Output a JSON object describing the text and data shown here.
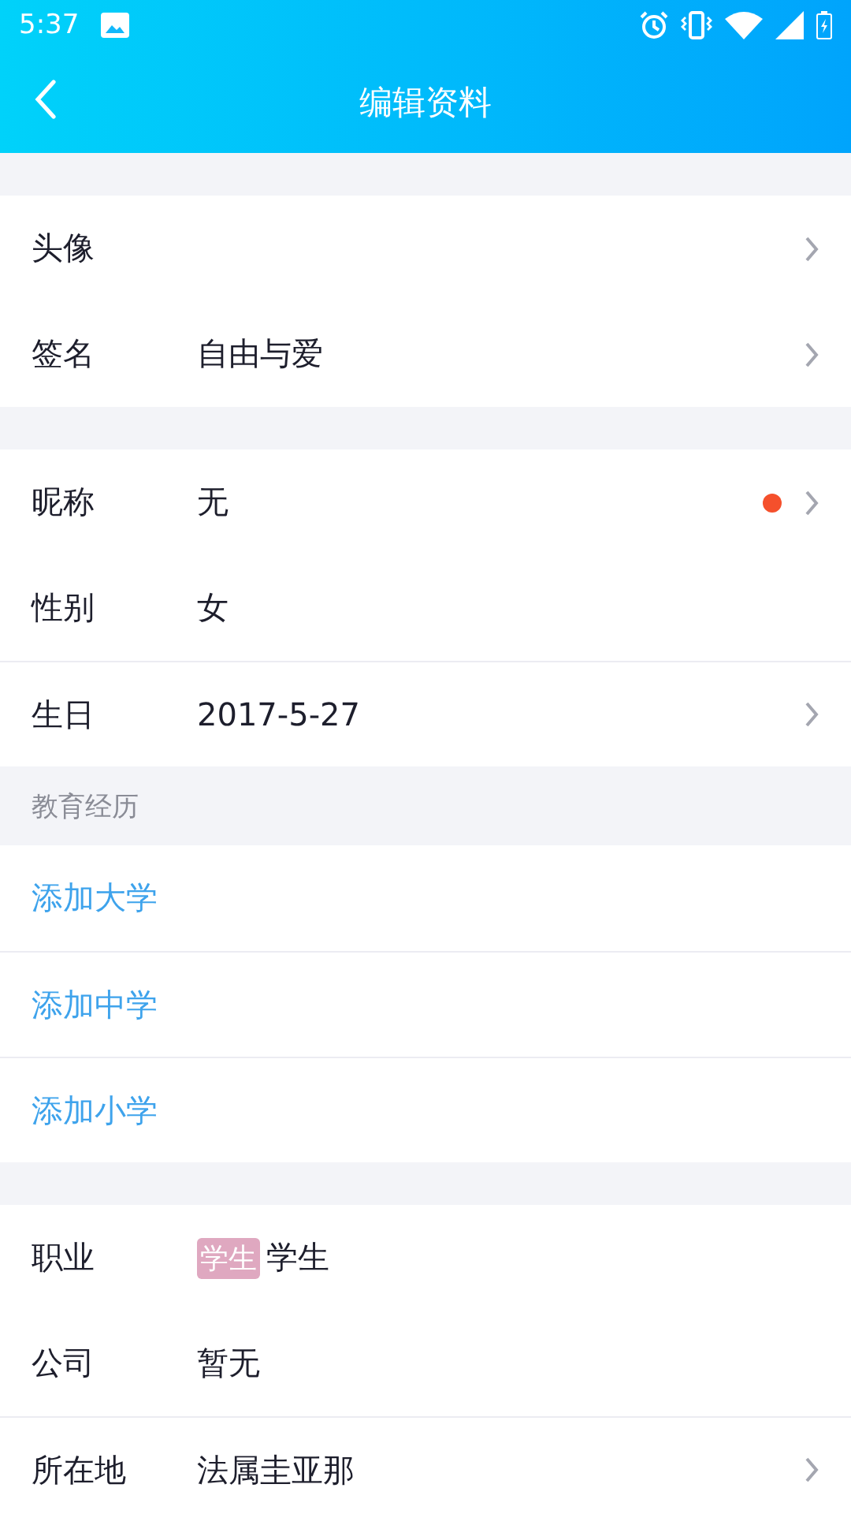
{
  "status_bar": {
    "time": "5:37"
  },
  "header": {
    "title": "编辑资料"
  },
  "sections": [
    {
      "rows": [
        {
          "kind": "field",
          "label": "头像",
          "chevron": true,
          "divider_above": false
        },
        {
          "kind": "field",
          "label": "签名",
          "value": "自由与爱",
          "chevron": true,
          "divider_above": false
        }
      ]
    },
    {
      "rows": [
        {
          "kind": "field",
          "label": "昵称",
          "value": "无",
          "dot": true,
          "chevron": true,
          "divider_above": false
        },
        {
          "kind": "field",
          "label": "性别",
          "value": "女",
          "chevron": false,
          "divider_above": false
        },
        {
          "kind": "field",
          "label": "生日",
          "value": "2017-5-27",
          "chevron": true,
          "divider_above": true
        }
      ]
    },
    {
      "heading": "教育经历",
      "rows": [
        {
          "kind": "link",
          "label": "添加大学",
          "divider_above": false
        },
        {
          "kind": "link",
          "label": "添加中学",
          "divider_above": true
        },
        {
          "kind": "link",
          "label": "添加小学",
          "divider_above": true
        }
      ]
    },
    {
      "rows": [
        {
          "kind": "field",
          "label": "职业",
          "tag": "学生",
          "value": "学生",
          "chevron": false,
          "divider_above": false
        },
        {
          "kind": "field",
          "label": "公司",
          "value": "暂无",
          "chevron": false,
          "divider_above": false
        },
        {
          "kind": "field",
          "label": "所在地",
          "value": "法属圭亚那",
          "chevron": true,
          "divider_above": true
        }
      ]
    }
  ]
}
